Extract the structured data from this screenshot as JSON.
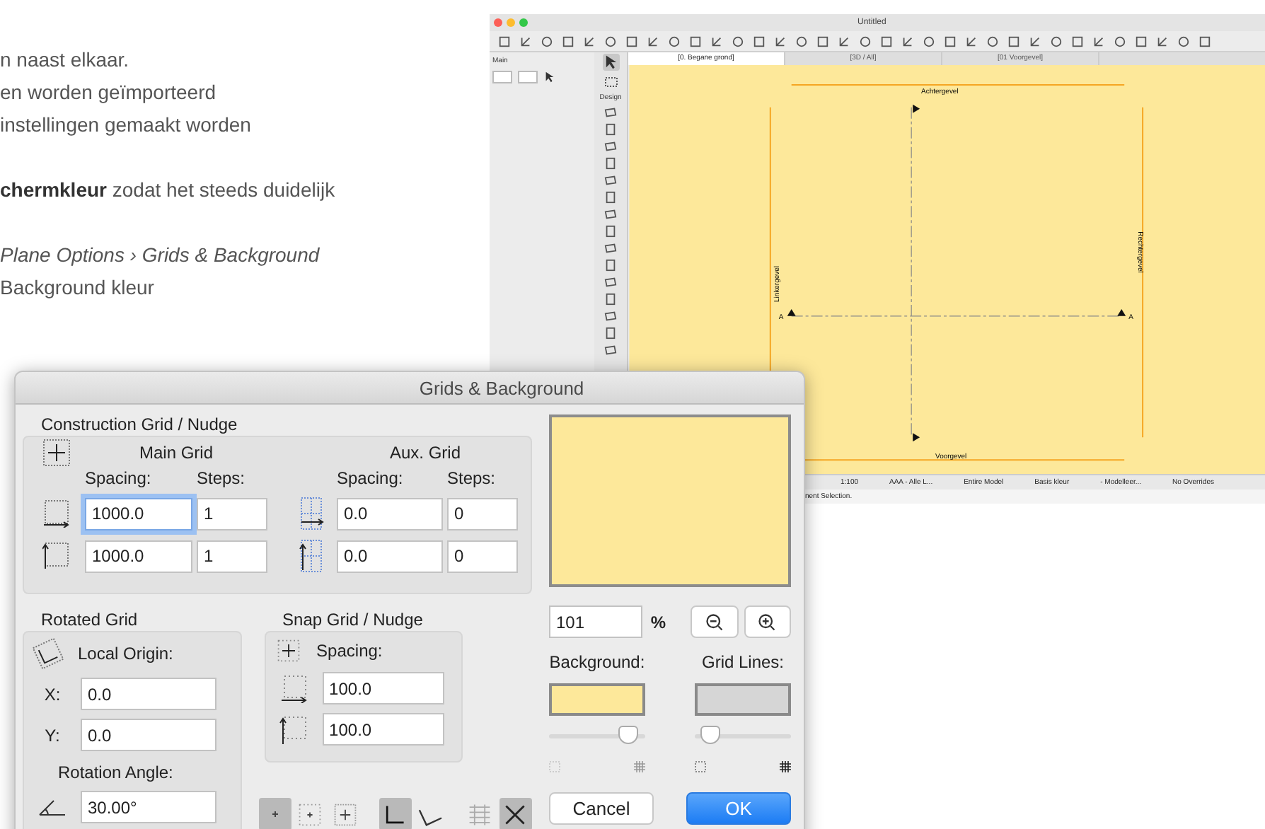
{
  "article": {
    "paragraphs": [
      {
        "lines": [
          {
            "kind": "plain",
            "text": "n naast elkaar."
          },
          {
            "kind": "plain",
            "text": "en worden geïmporteerd"
          },
          {
            "kind": "plain",
            "text": "instellingen gemaakt worden"
          }
        ]
      },
      {
        "lines": [
          {
            "kind": "plain",
            "text": "**chermkleur** zodat het steeds duidelijk"
          }
        ]
      },
      {
        "lines": [
          {
            "kind": "italic",
            "text": "Plane Options › Grids & Background"
          },
          {
            "kind": "plain",
            "text": "Background kleur"
          }
        ]
      }
    ]
  },
  "app_window": {
    "title": "Untitled",
    "palette_label": "Main",
    "tool_group_label": "Design",
    "view_tabs": [
      {
        "label": "[0. Begane grond]",
        "selected": true
      },
      {
        "label": "[3D / All]",
        "selected": false
      },
      {
        "label": "[01 Voorgevel]",
        "selected": false
      }
    ],
    "canvas_labels": {
      "top": "Achtergevel",
      "left": "Linkergevel",
      "right": "Rechtergevel",
      "bottom": "Voorgevel",
      "marker_left": "A",
      "marker_right": "A"
    },
    "status_items": [
      "1:100",
      "AAA - Alle L...",
      "Entire Model",
      "Basis kleur",
      "- Modelleer...",
      "No Overrides"
    ],
    "status_message": "nent Selection."
  },
  "dialog": {
    "title": "Grids & Background",
    "construction": {
      "title": "Construction Grid / Nudge",
      "main_title": "Main Grid",
      "aux_title": "Aux. Grid",
      "main_spacing_label": "Spacing:",
      "main_steps_label": "Steps:",
      "aux_spacing_label": "Spacing:",
      "aux_steps_label": "Steps:",
      "rows": [
        {
          "main_spacing": {
            "value": "1000.0",
            "focused": true
          },
          "main_steps": {
            "value": "1",
            "focused": false
          },
          "aux_spacing": {
            "value": "0.0",
            "focused": false
          },
          "aux_steps": {
            "value": "0",
            "focused": false
          }
        },
        {
          "main_spacing": {
            "value": "1000.0",
            "focused": false
          },
          "main_steps": {
            "value": "1",
            "focused": false
          },
          "aux_spacing": {
            "value": "0.0",
            "focused": false
          },
          "aux_steps": {
            "value": "0",
            "focused": false
          }
        }
      ]
    },
    "rotated": {
      "title": "Rotated Grid",
      "origin_label": "Local Origin:",
      "fields": [
        {
          "label": "X:",
          "value": "0.0"
        },
        {
          "label": "Y:",
          "value": "0.0"
        }
      ],
      "angle_label": "Rotation Angle:",
      "angle": "30.00°"
    },
    "snap": {
      "title": "Snap Grid / Nudge",
      "spacing_label": "Spacing:",
      "values": [
        "100.0",
        "100.0"
      ]
    },
    "mode_buttons": [
      {
        "kind": "dot",
        "selected": true
      },
      {
        "kind": "dotgrid",
        "selected": false
      },
      {
        "kind": "crossgrid",
        "selected": false
      },
      {
        "kind": "ortho",
        "selected": true
      },
      {
        "kind": "rotated",
        "selected": false
      },
      {
        "kind": "lines",
        "selected": false
      },
      {
        "kind": "cross",
        "selected": true
      }
    ],
    "zoom": {
      "value": "101",
      "unit": "%"
    },
    "swatches": [
      {
        "label": "Background:",
        "color": "#fde89a",
        "level": 0.9
      },
      {
        "label": "Grid Lines:",
        "color": "#d6d6d6",
        "level": 0.08
      }
    ],
    "buttons": [
      {
        "label": "Cancel",
        "default": false
      },
      {
        "label": "OK",
        "default": true
      }
    ]
  }
}
